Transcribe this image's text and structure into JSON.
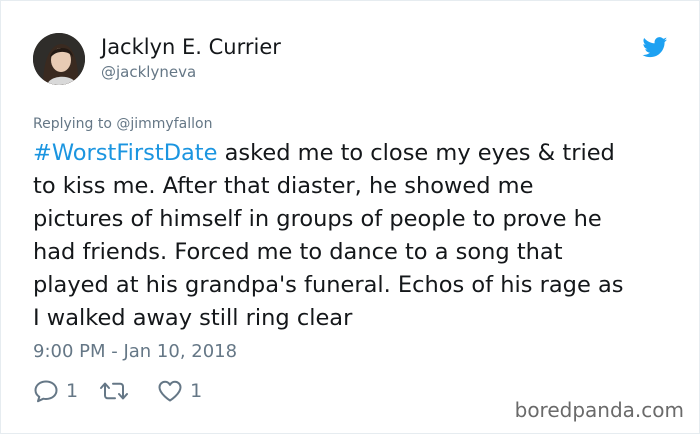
{
  "author": {
    "display_name": "Jacklyn E. Currier",
    "handle": "@jacklyneva",
    "avatar_icon": "user-avatar-photo"
  },
  "platform_icon": "twitter-bird-icon",
  "colors": {
    "link": "#1b95e0",
    "twitter_blue": "#1da1f2",
    "muted": "#657786",
    "text": "#14171a"
  },
  "replying_to": "Replying to @jimmyfallon",
  "tweet": {
    "hashtag": "#WorstFirstDate",
    "lines": [
      " asked me to close my eyes & tried",
      "to kiss me. After that diaster, he showed me",
      "pictures of himself in groups of people to prove he",
      "had friends. Forced me to dance to a song that",
      "played at his grandpa's funeral. Echos of his rage as",
      "I walked away still ring clear"
    ]
  },
  "timestamp": "9:00 PM - Jan 10, 2018",
  "actions": {
    "reply_count": "1",
    "retweet_count": "",
    "like_count": "1"
  },
  "watermark": "boredpanda.com"
}
